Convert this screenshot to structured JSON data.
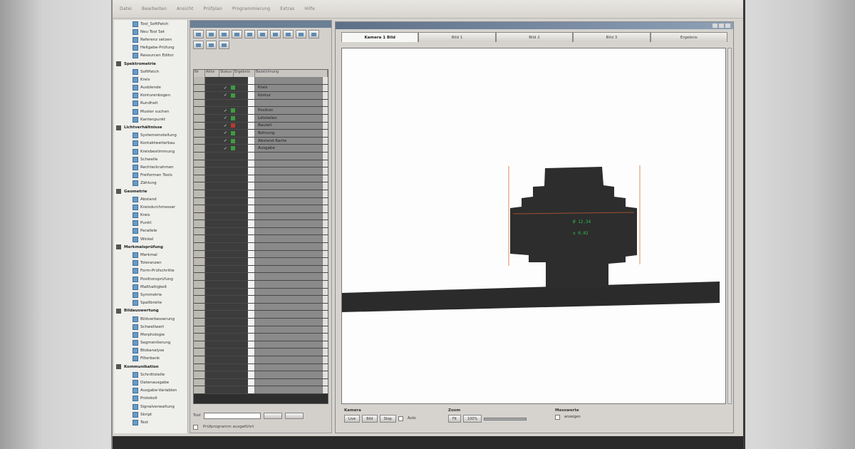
{
  "menubar": {
    "items": [
      "Datei",
      "Bearbeiten",
      "Ansicht",
      "Prüfplan",
      "Programmierung",
      "Extras",
      "Hilfe"
    ]
  },
  "tree": {
    "items": [
      {
        "type": "leaf",
        "label": "Tool_SoftPatch"
      },
      {
        "type": "leaf",
        "label": "Neu Tool Set"
      },
      {
        "type": "leaf",
        "label": "Referenz setzen"
      },
      {
        "type": "leaf",
        "label": "Hellgabe-Prüfung"
      },
      {
        "type": "leaf",
        "label": "Resourcen Editor"
      },
      {
        "type": "cat",
        "label": "Spektrometrie"
      },
      {
        "type": "leaf",
        "label": "SoftPatch"
      },
      {
        "type": "leaf",
        "label": "Kreis"
      },
      {
        "type": "leaf",
        "label": "Ausblende"
      },
      {
        "type": "leaf",
        "label": "Konturenbogen"
      },
      {
        "type": "leaf",
        "label": "Rundheit"
      },
      {
        "type": "leaf",
        "label": "Muster suchen"
      },
      {
        "type": "leaf",
        "label": "Kantenpunkt"
      },
      {
        "type": "cat",
        "label": "Lichtverhältnisse"
      },
      {
        "type": "leaf",
        "label": "Systemeinstellung"
      },
      {
        "type": "leaf",
        "label": "Kontaktweiterbau"
      },
      {
        "type": "leaf",
        "label": "Kreisbestimmung"
      },
      {
        "type": "leaf",
        "label": "Schwelle"
      },
      {
        "type": "leaf",
        "label": "Rechteckrahmen"
      },
      {
        "type": "leaf",
        "label": "Freiformen Tools"
      },
      {
        "type": "leaf",
        "label": "Zählung"
      },
      {
        "type": "cat",
        "label": "Geometrie"
      },
      {
        "type": "leaf",
        "label": "Abstand"
      },
      {
        "type": "leaf",
        "label": "Kreisdurchmesser"
      },
      {
        "type": "leaf",
        "label": "Kreis"
      },
      {
        "type": "leaf",
        "label": "Punkt"
      },
      {
        "type": "leaf",
        "label": "Parallele"
      },
      {
        "type": "leaf",
        "label": "Winkel"
      },
      {
        "type": "cat",
        "label": "Merkmalsprüfung"
      },
      {
        "type": "leaf",
        "label": "Merkmal"
      },
      {
        "type": "leaf",
        "label": "Toleranzen"
      },
      {
        "type": "leaf",
        "label": "Form-Prüfschritte"
      },
      {
        "type": "leaf",
        "label": "Positionsprüfung"
      },
      {
        "type": "leaf",
        "label": "Maßhaltigkeit"
      },
      {
        "type": "leaf",
        "label": "Symmetrie"
      },
      {
        "type": "leaf",
        "label": "Spaltbreite"
      },
      {
        "type": "cat",
        "label": "Bildauswertung"
      },
      {
        "type": "leaf",
        "label": "Bildverbesserung"
      },
      {
        "type": "leaf",
        "label": "Schwellwert"
      },
      {
        "type": "leaf",
        "label": "Morphologie"
      },
      {
        "type": "leaf",
        "label": "Segmentierung"
      },
      {
        "type": "leaf",
        "label": "Blobanalyse"
      },
      {
        "type": "leaf",
        "label": "Filterbank"
      },
      {
        "type": "cat",
        "label": "Kommunikation"
      },
      {
        "type": "leaf",
        "label": "Schnittstelle"
      },
      {
        "type": "leaf",
        "label": "Datenausgabe"
      },
      {
        "type": "leaf",
        "label": "Ausgabe-Variablen"
      },
      {
        "type": "leaf",
        "label": "Protokoll"
      },
      {
        "type": "leaf",
        "label": "Signalverwaltung"
      },
      {
        "type": "leaf",
        "label": "Skript"
      },
      {
        "type": "leaf",
        "label": "Text"
      }
    ]
  },
  "middle": {
    "grid_header": [
      "Nr",
      "Aktiv",
      "Status",
      "Ergebnis",
      "Bezeichnung"
    ],
    "rows": [
      {
        "check": "",
        "flag": "none",
        "name": ""
      },
      {
        "check": "✓",
        "flag": "green",
        "name": "Kreis"
      },
      {
        "check": "✓",
        "flag": "green",
        "name": "Kontur"
      },
      {
        "check": "",
        "flag": "none",
        "name": ""
      },
      {
        "check": "✓",
        "flag": "green",
        "name": "Position"
      },
      {
        "check": "✓",
        "flag": "green",
        "name": "Lötstellen"
      },
      {
        "check": "✓",
        "flag": "red",
        "name": "Bauteil"
      },
      {
        "check": "✓",
        "flag": "green",
        "name": "Bohrung"
      },
      {
        "check": "✓",
        "flag": "green",
        "name": "Abstand Kante"
      },
      {
        "check": "✓",
        "flag": "green",
        "name": "Ausgabe"
      }
    ],
    "empty_rows": 32,
    "bottom": {
      "label": "Tool",
      "status_text": "Prüfprogramm ausgeführt"
    }
  },
  "camera": {
    "tabs": [
      {
        "label": "Kamera 1 Bild",
        "active": true
      },
      {
        "label": "Bild 1",
        "active": false
      },
      {
        "label": "Bild 2",
        "active": false
      },
      {
        "label": "Bild 3",
        "active": false
      },
      {
        "label": "Ergebnis",
        "active": false
      }
    ],
    "readouts": [
      "Ø 12.34",
      "± 0.02"
    ],
    "controls": {
      "group1": {
        "label": "Kamera",
        "buttons": [
          "Live",
          "Bild",
          "Stop"
        ],
        "extra": "Auto"
      },
      "group2": {
        "label": "Zoom",
        "buttons": [
          "Fit",
          "100%"
        ]
      },
      "group3": {
        "label": "Messwerte",
        "check": "anzeigen"
      }
    }
  },
  "colors": {
    "accent_green": "#2fbf4f",
    "guide_orange": "#e08a5a",
    "part_dark": "#2d2d2d"
  }
}
